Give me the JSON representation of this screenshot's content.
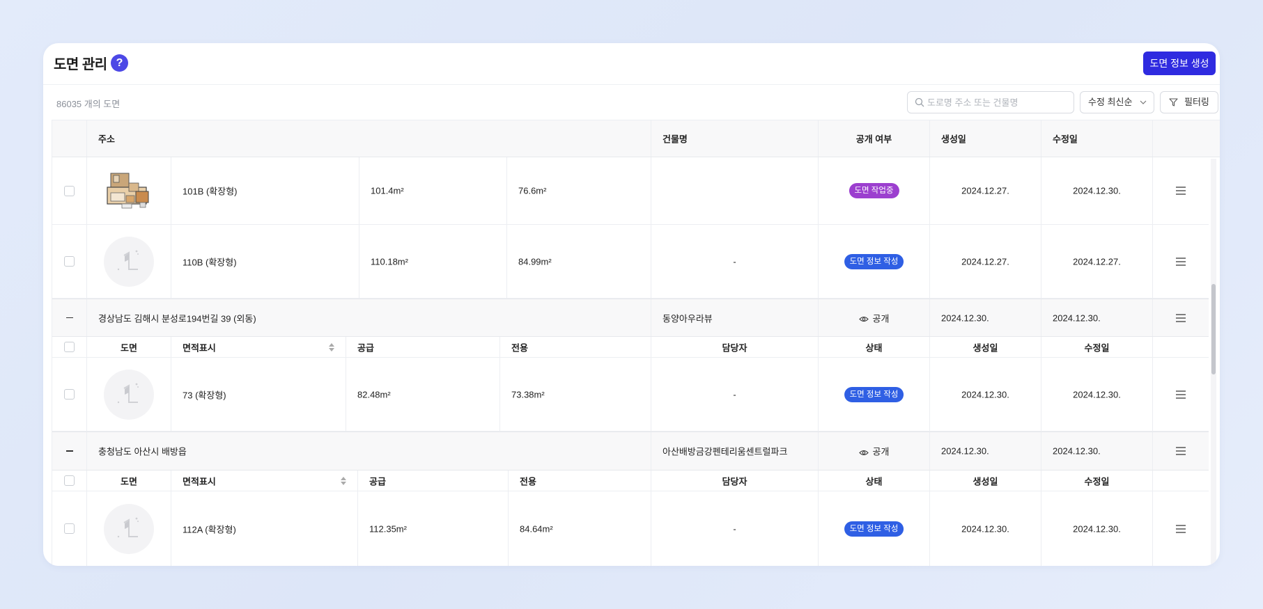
{
  "header": {
    "title": "도면 관리",
    "help_symbol": "?",
    "create_button": "도면 정보 생성"
  },
  "toolbar": {
    "count_text": "86035 개의 도면",
    "search_placeholder": "도로명 주소 또는 건물명",
    "sort_label": "수정 최신순",
    "filter_label": "필터링"
  },
  "columns": {
    "address": "주소",
    "building": "건물명",
    "visibility": "공개 여부",
    "created": "생성일",
    "modified": "수정일"
  },
  "subcolumns": {
    "drawing": "도면",
    "area": "면적표시",
    "supply": "공급",
    "exclusive": "전용",
    "manager": "담당자",
    "status": "상태",
    "created": "생성일",
    "modified": "수정일"
  },
  "rows": [
    {
      "area": "101B (확장형)",
      "supply": "101.4m²",
      "exclusive": "76.6m²",
      "manager": "",
      "status": "도면 작업중",
      "status_color": "#9c3fcf",
      "created": "2024.12.27.",
      "modified": "2024.12.30.",
      "thumb": "floorplan"
    },
    {
      "area": "110B (확장형)",
      "supply": "110.18m²",
      "exclusive": "84.99m²",
      "manager": "-",
      "status": "도면 정보 작성",
      "status_color": "#2f5fe4",
      "created": "2024.12.27.",
      "modified": "2024.12.27.",
      "thumb": "placeholder"
    }
  ],
  "groups": [
    {
      "address": "경상남도 김해시 분성로194번길 39 (외동)",
      "building": "동양아우라뷰",
      "visibility": "공개",
      "created": "2024.12.30.",
      "modified": "2024.12.30.",
      "items": [
        {
          "area": "73 (확장형)",
          "supply": "82.48m²",
          "exclusive": "73.38m²",
          "manager": "-",
          "status": "도면 정보 작성",
          "created": "2024.12.30.",
          "modified": "2024.12.30."
        }
      ]
    },
    {
      "address": "충청남도 아산시 배방읍",
      "building": "아산배방금강펜테리움센트럴파크",
      "visibility": "공개",
      "created": "2024.12.30.",
      "modified": "2024.12.30.",
      "items": [
        {
          "area": "112A (확장형)",
          "supply": "112.35m²",
          "exclusive": "84.64m²",
          "manager": "-",
          "status": "도면 정보 작성",
          "created": "2024.12.30.",
          "modified": "2024.12.30."
        }
      ]
    }
  ],
  "colors": {
    "accent": "#2f2be0",
    "help": "#4c48e6",
    "status_working": "#9c3fcf",
    "status_info": "#2f5fe4"
  },
  "icons": [
    "help-icon",
    "search-icon",
    "chevron-down-icon",
    "filter-icon",
    "eye-icon",
    "hamburger-menu-icon",
    "sort-arrows-icon",
    "floorplan-thumbnail",
    "placeholder-thumbnail"
  ]
}
